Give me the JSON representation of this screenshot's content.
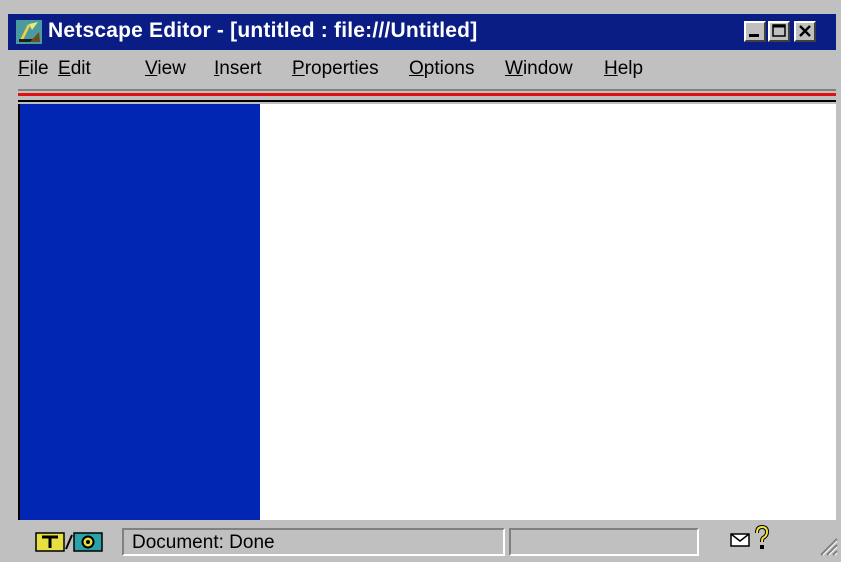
{
  "window": {
    "title": "Netscape Editor - [untitled : file:///Untitled]"
  },
  "menu": [
    {
      "first": "F",
      "rest": "ile"
    },
    {
      "first": "E",
      "rest": "dit"
    },
    {
      "first": "V",
      "rest": "iew"
    },
    {
      "first": "I",
      "rest": "nsert"
    },
    {
      "first": "P",
      "rest": "roperties"
    },
    {
      "first": "O",
      "rest": "ptions"
    },
    {
      "first": "W",
      "rest": "indow"
    },
    {
      "first": "H",
      "rest": "elp"
    }
  ],
  "status": {
    "message": "Document: Done",
    "progress": ""
  },
  "icons": {
    "app": "netscape-editor-icon",
    "minimize": "minimize-icon",
    "maximize": "maximize-icon",
    "close": "close-icon",
    "security": "security-icon",
    "mail": "mail-icon",
    "help": "help-icon",
    "grip": "resize-grip-icon"
  },
  "colors": {
    "titlebar": "#0a1d84",
    "left_pane": "#0026b3",
    "editor_bg": "#ffffff",
    "separator": "#e01010"
  }
}
